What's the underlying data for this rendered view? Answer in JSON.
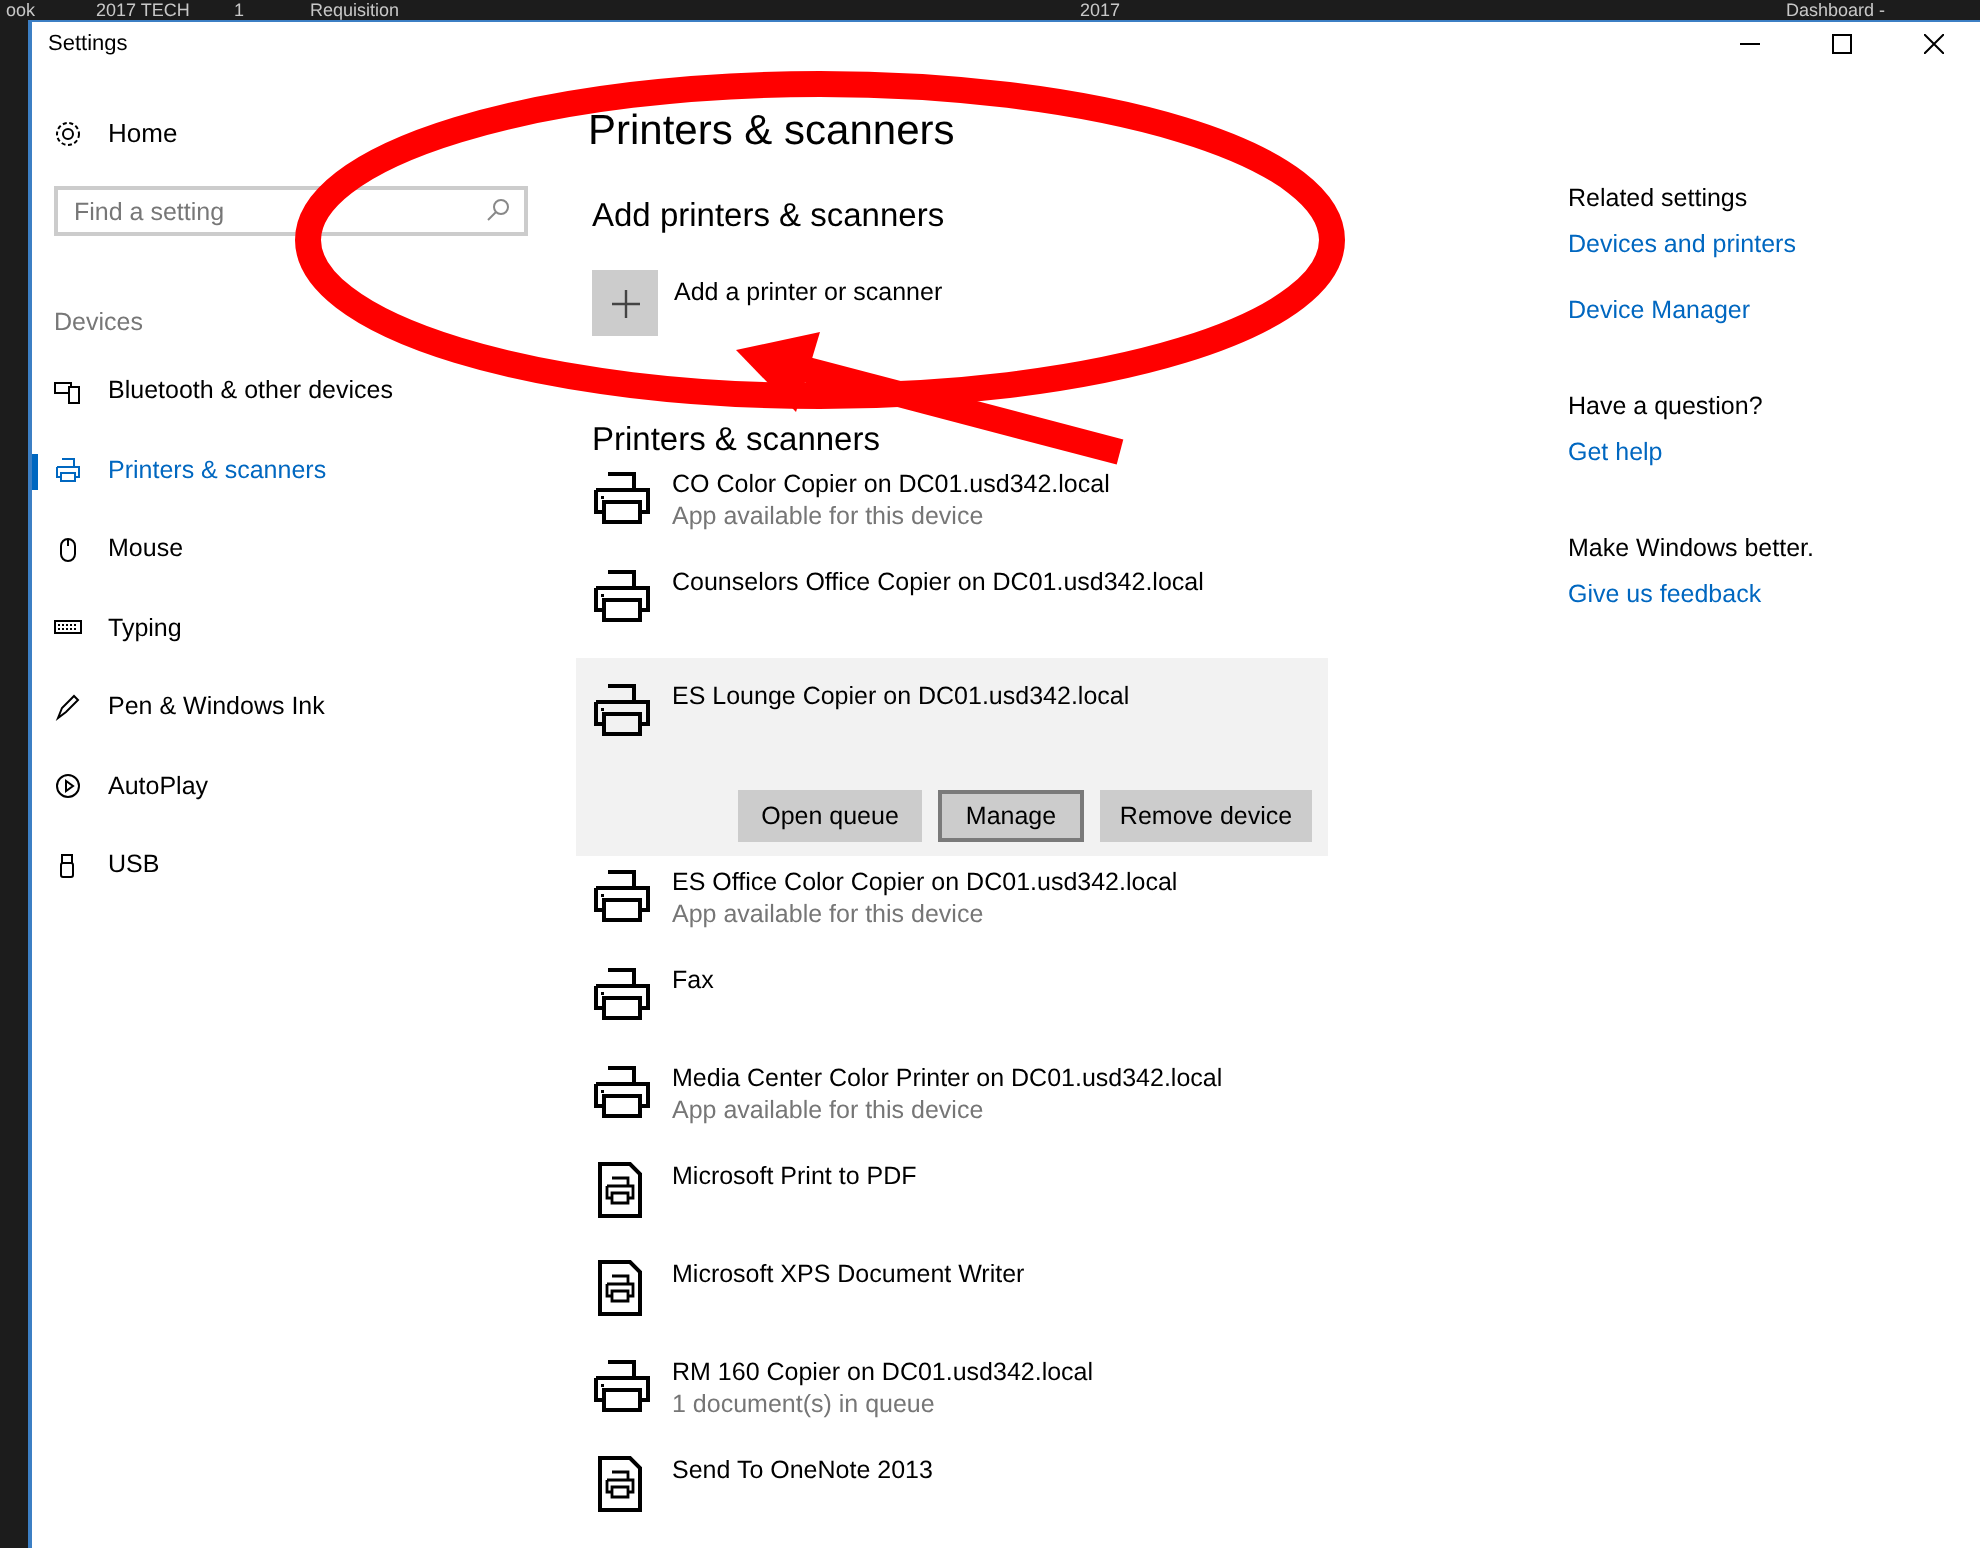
{
  "background_window": {
    "texts": [
      "ook",
      "2017 TECH",
      "1",
      "Requisition",
      "2017",
      "Dashboard -"
    ]
  },
  "window": {
    "title": "Settings"
  },
  "sidebar": {
    "home": "Home",
    "search": {
      "placeholder": "Find a setting"
    },
    "section": "Devices",
    "items": [
      {
        "label": "Bluetooth & other devices",
        "selected": false
      },
      {
        "label": "Printers & scanners",
        "selected": true
      },
      {
        "label": "Mouse",
        "selected": false
      },
      {
        "label": "Typing",
        "selected": false
      },
      {
        "label": "Pen & Windows Ink",
        "selected": false
      },
      {
        "label": "AutoPlay",
        "selected": false
      },
      {
        "label": "USB",
        "selected": false
      }
    ]
  },
  "main": {
    "title": "Printers & scanners",
    "add_section": {
      "heading": "Add printers & scanners",
      "button": "Add a printer or scanner"
    },
    "list_heading": "Printers & scanners",
    "printers": [
      {
        "kind": "printer",
        "name": "CO Color Copier on DC01.usd342.local",
        "status": "App available for this device",
        "expanded": false
      },
      {
        "kind": "printer",
        "name": "Counselors Office Copier on DC01.usd342.local",
        "expanded": false
      },
      {
        "kind": "printer",
        "name": "ES Lounge Copier on DC01.usd342.local",
        "expanded": true,
        "actions": [
          {
            "label": "Open queue",
            "focused": false
          },
          {
            "label": "Manage",
            "focused": true
          },
          {
            "label": "Remove device",
            "focused": false
          }
        ]
      },
      {
        "kind": "printer",
        "name": "ES Office Color Copier on DC01.usd342.local",
        "status": "App available for this device",
        "expanded": false
      },
      {
        "kind": "printer",
        "name": "Fax",
        "expanded": false
      },
      {
        "kind": "printer",
        "name": "Media Center Color Printer on DC01.usd342.local",
        "status": "App available for this device",
        "expanded": false
      },
      {
        "kind": "document",
        "name": "Microsoft Print to PDF",
        "expanded": false
      },
      {
        "kind": "document",
        "name": "Microsoft XPS Document Writer",
        "expanded": false
      },
      {
        "kind": "printer",
        "name": "RM 160 Copier on DC01.usd342.local",
        "status": "1 document(s) in queue",
        "expanded": false
      },
      {
        "kind": "document",
        "name": "Send To OneNote 2013",
        "expanded": false
      }
    ]
  },
  "right_panel": [
    {
      "heading": "Related settings",
      "links": [
        "Devices and printers",
        "Device Manager"
      ]
    },
    {
      "heading": "Have a question?",
      "links": [
        "Get help"
      ]
    },
    {
      "heading": "Make Windows better.",
      "links": [
        "Give us feedback"
      ]
    }
  ]
}
